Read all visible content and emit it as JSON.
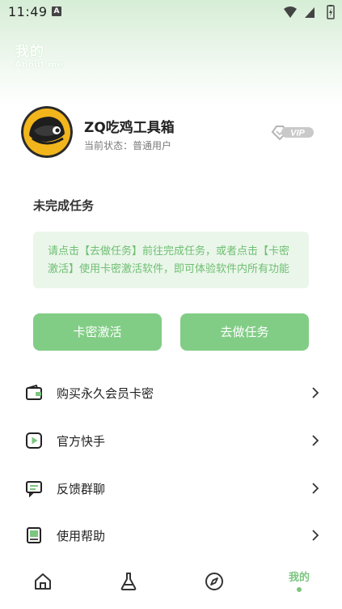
{
  "status_bar": {
    "time": "11:49",
    "notification_glyph": "A"
  },
  "header": {
    "title": "我的",
    "subtitle": "About me"
  },
  "profile": {
    "name": "ZQ吃鸡工具箱",
    "status": "当前状态：普通用户",
    "badge": "VIP"
  },
  "tasks": {
    "title": "未完成任务",
    "message": "请点击【去做任务】前往完成任务，或者点击【卡密激活】使用卡密激活软件，即可体验软件内所有功能"
  },
  "buttons": {
    "activate": "卡密激活",
    "do_task": "去做任务"
  },
  "menu": [
    {
      "label": "购买永久会员卡密",
      "icon": "wallet-icon"
    },
    {
      "label": "官方快手",
      "icon": "video-play-icon"
    },
    {
      "label": "反馈群聊",
      "icon": "chat-icon"
    },
    {
      "label": "使用帮助",
      "icon": "book-icon"
    }
  ],
  "tabbar": {
    "active_label": "我的"
  },
  "colors": {
    "accent": "#82cd86",
    "accent_text": "#6fbf73",
    "task_bg": "#eaf6ea"
  }
}
